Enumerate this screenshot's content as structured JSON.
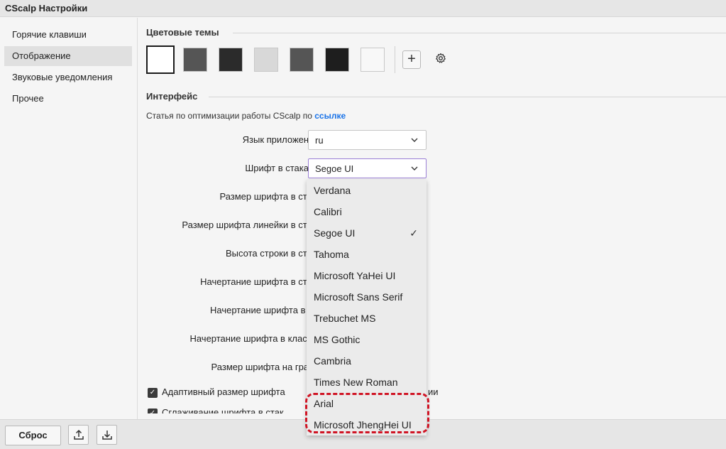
{
  "window": {
    "title": "CScalp Настройки"
  },
  "sidebar": {
    "items": [
      {
        "label": "Горячие клавиши"
      },
      {
        "label": "Отображение"
      },
      {
        "label": "Звуковые уведомления"
      },
      {
        "label": "Прочее"
      }
    ]
  },
  "themes": {
    "title": "Цветовые темы",
    "swatches": [
      "#ffffff",
      "#555555",
      "#2b2b2b",
      "#d8d8d8",
      "#555555",
      "#1e1e1e",
      "#f8f8f8"
    ],
    "add_label": "+",
    "settings_icon": "gear-icon"
  },
  "interface": {
    "title": "Интерфейс",
    "article_text": "Статья по оптимизации работы CScalp по ",
    "article_link": "ссылке",
    "rows": [
      {
        "label": "Язык приложения:",
        "value": "ru"
      },
      {
        "label": "Шрифт в стакане:",
        "value": "Segoe UI"
      },
      {
        "label": "Размер шрифта в стака"
      },
      {
        "label": "Размер шрифта линейки в стака"
      },
      {
        "label": "Высота строки в стака"
      },
      {
        "label": "Начертание шрифта в стака"
      },
      {
        "label": "Начертание шрифта в тик"
      },
      {
        "label": "Начертание шрифта в кластер"
      },
      {
        "label": "Размер шрифта на графи"
      }
    ],
    "checkboxes": [
      {
        "label": "Адаптивный размер шрифта",
        "trailing": "ии",
        "checked": true
      },
      {
        "label": "Сглаживание шрифта в стак",
        "checked": true
      }
    ]
  },
  "font_dropdown": {
    "options": [
      "Verdana",
      "Calibri",
      "Segoe UI",
      "Tahoma",
      "Microsoft YaHei UI",
      "Microsoft Sans Serif",
      "Trebuchet MS",
      "MS Gothic",
      "Cambria",
      "Times New Roman",
      "Arial",
      "Microsoft JhengHei UI"
    ],
    "selected": "Segoe UI",
    "highlight_color": "#d01424"
  },
  "footer": {
    "reset_label": "Сброс",
    "export_icon": "upload-icon",
    "import_icon": "download-icon"
  }
}
